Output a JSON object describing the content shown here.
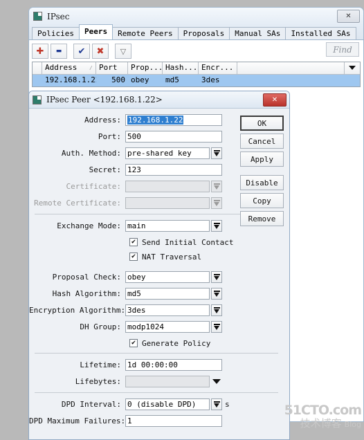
{
  "main_window": {
    "title": "IPsec",
    "icon": "app-icon",
    "close_label": "✕",
    "tabs": [
      {
        "label": "Policies",
        "active": false
      },
      {
        "label": "Peers",
        "active": true
      },
      {
        "label": "Remote Peers",
        "active": false
      },
      {
        "label": "Proposals",
        "active": false
      },
      {
        "label": "Manual SAs",
        "active": false
      },
      {
        "label": "Installed SAs",
        "active": false
      }
    ],
    "toolbar": {
      "buttons": [
        {
          "name": "add-button",
          "glyph": "✚",
          "color": "#c0392b"
        },
        {
          "name": "remove-button",
          "glyph": "▬",
          "color": "#1f3a93"
        },
        {
          "name": "enable-button",
          "glyph": "✔",
          "color": "#1f3a93"
        },
        {
          "name": "disable-button",
          "glyph": "✖",
          "color": "#c0392b"
        },
        {
          "name": "filter-button",
          "glyph": "▽",
          "color": "#555555"
        }
      ],
      "find_placeholder": "Find"
    },
    "table": {
      "columns": [
        "",
        "Address",
        "Port",
        "Prop...",
        "Hash...",
        "Encr...",
        "",
        ""
      ],
      "sort_indicator": "⁄",
      "rows": [
        {
          "marker": "",
          "address": "192.168.1.22",
          "port": "500",
          "proposal_check": "obey",
          "hash": "md5",
          "encryption": "3des",
          "selected": true
        }
      ]
    }
  },
  "dialog": {
    "title": "IPsec Peer <192.168.1.22>",
    "icon": "app-icon",
    "close_label": "✕",
    "fields": {
      "address_label": "Address:",
      "address_value": "192.168.1.22",
      "port_label": "Port:",
      "port_value": "500",
      "auth_method_label": "Auth. Method:",
      "auth_method_value": "pre-shared key",
      "secret_label": "Secret:",
      "secret_value": "123",
      "certificate_label": "Certificate:",
      "certificate_value": "",
      "remote_certificate_label": "Remote Certificate:",
      "remote_certificate_value": "",
      "exchange_mode_label": "Exchange Mode:",
      "exchange_mode_value": "main",
      "send_initial_contact_label": "Send Initial Contact",
      "nat_traversal_label": "NAT Traversal",
      "proposal_check_label": "Proposal Check:",
      "proposal_check_value": "obey",
      "hash_algorithm_label": "Hash Algorithm:",
      "hash_algorithm_value": "md5",
      "encryption_algorithm_label": "Encryption Algorithm:",
      "encryption_algorithm_value": "3des",
      "dh_group_label": "DH Group:",
      "dh_group_value": "modp1024",
      "generate_policy_label": "Generate Policy",
      "lifetime_label": "Lifetime:",
      "lifetime_value": "1d 00:00:00",
      "lifebytes_label": "Lifebytes:",
      "lifebytes_value": "",
      "dpd_interval_label": "DPD Interval:",
      "dpd_interval_value": "0 (disable DPD)",
      "dpd_interval_unit": "s",
      "dpd_max_failures_label": "DPD Maximum Failures:",
      "dpd_max_failures_value": "1"
    },
    "checkboxes": {
      "send_initial_contact": "✔",
      "nat_traversal": "✔",
      "generate_policy": "✔"
    },
    "buttons": [
      {
        "label": "OK",
        "default": true
      },
      {
        "label": "Cancel",
        "default": false
      },
      {
        "label": "Apply",
        "default": false
      },
      {
        "label": "Disable",
        "default": false
      },
      {
        "label": "Copy",
        "default": false
      },
      {
        "label": "Remove",
        "default": false
      }
    ]
  },
  "watermark": {
    "line1": "51CTO.com",
    "line2": "技术博客",
    "line2_suffix": "Blog"
  }
}
